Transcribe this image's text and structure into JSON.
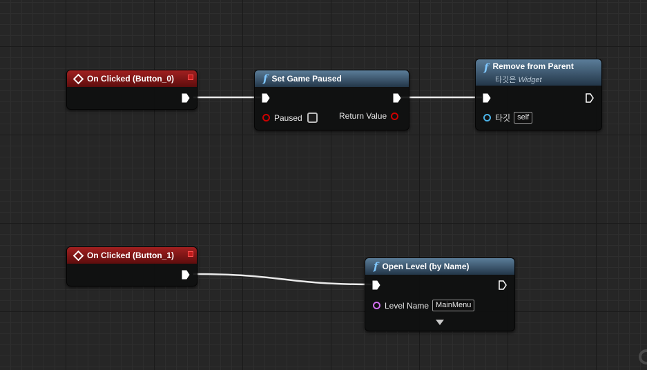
{
  "nodes": {
    "on_clicked_0": {
      "title": "On Clicked (Button_0)"
    },
    "set_game_paused": {
      "title": "Set Game Paused",
      "pin_paused": "Paused",
      "paused_value": false,
      "pin_return": "Return Value"
    },
    "remove_from_parent": {
      "title": "Remove from Parent",
      "target_prefix": "타깃은",
      "target_class": "Widget",
      "pin_target": "타깃",
      "target_value": "self"
    },
    "on_clicked_1": {
      "title": "On Clicked (Button_1)"
    },
    "open_level": {
      "title": "Open Level (by Name)",
      "pin_level_name": "Level Name",
      "level_name_value": "MainMenu"
    }
  },
  "icons": {
    "event": "event-diamond-icon",
    "function": "function-f-icon",
    "exec": "exec-pin-icon",
    "delegate": "delegate-pin-icon"
  },
  "colors": {
    "event_header": "#a12020",
    "function_header": "#5b7d99",
    "bool_pin": "#c00000",
    "object_pin": "#4ab3e8",
    "name_pin": "#d16ff0",
    "wire": "#ffffff"
  }
}
